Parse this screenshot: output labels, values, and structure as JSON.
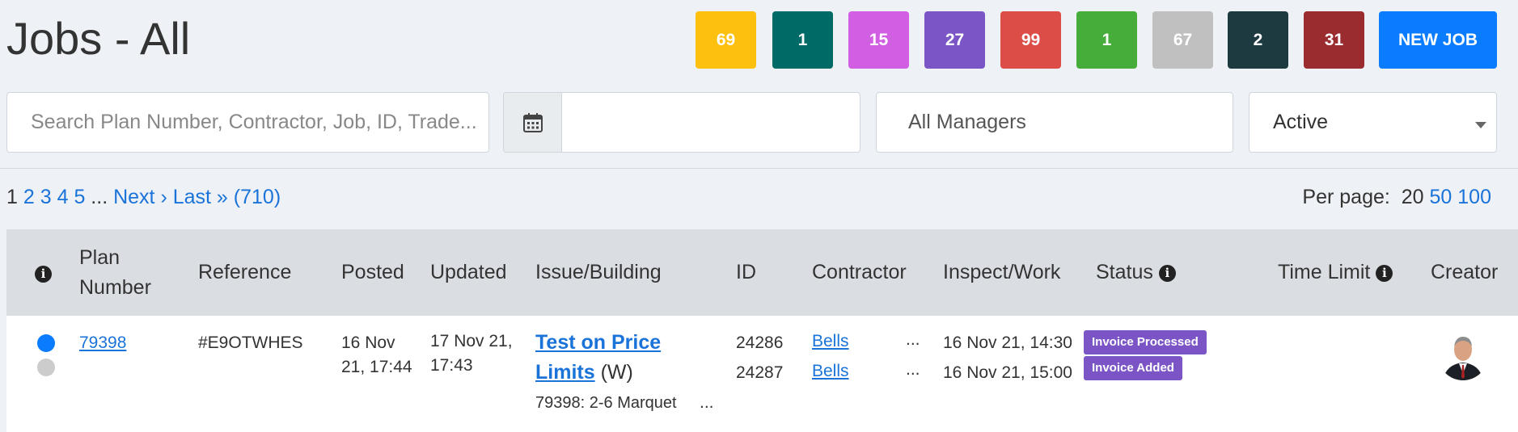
{
  "page": {
    "title": "Jobs - All"
  },
  "tiles": [
    {
      "value": "69",
      "color": "#fdc00f"
    },
    {
      "value": "1",
      "color": "#006b66"
    },
    {
      "value": "15",
      "color": "#d15ee3"
    },
    {
      "value": "27",
      "color": "#7b55c6"
    },
    {
      "value": "99",
      "color": "#dd4d48"
    },
    {
      "value": "1",
      "color": "#46ac3a"
    },
    {
      "value": "67",
      "color": "#c0c0c0"
    },
    {
      "value": "2",
      "color": "#1e3a41"
    },
    {
      "value": "31",
      "color": "#9a2c2f"
    }
  ],
  "toolbar": {
    "new_job_label": "NEW JOB"
  },
  "filters": {
    "search_placeholder": "Search Plan Number, Contractor, Job, ID, Trade...",
    "date_value": "",
    "managers_value": "All Managers",
    "status_value": "Active"
  },
  "pager": {
    "current": "1",
    "pages": [
      "2",
      "3",
      "4",
      "5"
    ],
    "ellipsis": "...",
    "next": "Next ›",
    "last": "Last »",
    "total": "(710)"
  },
  "per_page": {
    "label": "Per page:",
    "current": "20",
    "options": [
      "50",
      "100"
    ]
  },
  "table": {
    "headers": {
      "plan_number": "Plan Number",
      "reference": "Reference",
      "posted": "Posted",
      "updated": "Updated",
      "issue": "Issue/Building",
      "id": "ID",
      "contractor": "Contractor",
      "inspect": "Inspect/Work",
      "status": "Status",
      "time_limit": "Time Limit",
      "creator": "Creator"
    },
    "rows": [
      {
        "dot_colors": [
          "#0a7cff",
          "#cccccc"
        ],
        "plan_number": "79398",
        "reference": "#E9OTWHES",
        "posted": "16 Nov 21, 17:44",
        "updated": "17 Nov 21, 17:43",
        "issue_title": "Test on Price Limits",
        "issue_suffix": " (W)",
        "issue_building": "79398: 2-6 Marquet",
        "issue_more": "...",
        "ids": [
          "24286",
          "24287"
        ],
        "contractors": [
          "Bells",
          "Bells"
        ],
        "contractor_more": "...",
        "inspect": [
          "16 Nov 21, 14:30",
          "16 Nov 21, 15:00"
        ],
        "statuses": [
          {
            "label": "Invoice Processed",
            "color": "#7b55c6"
          },
          {
            "label": "Invoice Added",
            "color": "#7b55c6"
          }
        ]
      }
    ]
  }
}
